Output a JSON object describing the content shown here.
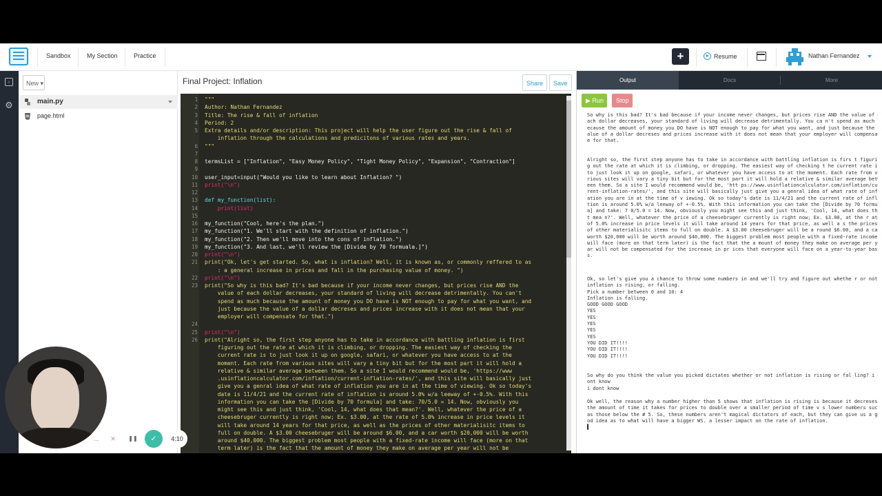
{
  "nav": {
    "links": [
      "Sandbox",
      "My Section",
      "Practice"
    ],
    "plus_label": "+",
    "resume_label": "Resume",
    "user_name": "Nathan Fernandez"
  },
  "files": {
    "new_label": "New",
    "items": [
      "main.py",
      "page.html"
    ]
  },
  "editor": {
    "title": "Final Project: Inflation",
    "share_label": "Share",
    "save_label": "Save",
    "lines": [
      {
        "n": "1",
        "t": "\"\"\""
      },
      {
        "n": "2",
        "t": "Author: Nathan Fernandez"
      },
      {
        "n": "3",
        "t": "Title: The rise & fall of inflation"
      },
      {
        "n": "4",
        "t": "Period: 2"
      },
      {
        "n": "5",
        "t": "Extra details and/or description: This project will help the user figure out the rise & fall of\n    inflation through the calculations and predicitons of various rates and years."
      },
      {
        "n": "6",
        "t": "\"\"\""
      },
      {
        "n": "7",
        "t": ""
      },
      {
        "n": "8",
        "t": "termsList = [\"Inflation\", \"Easy Money Policy\", \"Tight Money Policy\", \"Expansion\", \"Contraction\"]"
      },
      {
        "n": "9",
        "t": ""
      },
      {
        "n": "10",
        "t": "user_input=input(\"Would you like to learn about Inflation? \")"
      },
      {
        "n": "11",
        "t": "print(\"\\n\")"
      },
      {
        "n": "12",
        "t": ""
      },
      {
        "n": "13",
        "t": "def my_function(list):"
      },
      {
        "n": "14",
        "t": "    print(list)"
      },
      {
        "n": "15",
        "t": ""
      },
      {
        "n": "16",
        "t": "my_function(\"Cool, here's the plan.\")"
      },
      {
        "n": "17",
        "t": "my_function(\"1. We'll start with the definition of inflation.\")"
      },
      {
        "n": "18",
        "t": "my_function(\"2. Then we'll move into the cons of inflation.\")"
      },
      {
        "n": "19",
        "t": "my_function(\"3. And last, we'll review the [Divide by 70 formuala.]\")"
      },
      {
        "n": "20",
        "t": "print(\"\\n\")"
      },
      {
        "n": "21",
        "t": "print(\"Ok, let's get started. So, what is inflation? Well, it is known as, or commonly reffered to as\n    : a general increase in prices and fall in the purchasing value of money. \")"
      },
      {
        "n": "22",
        "t": "print(\"\\n\")"
      },
      {
        "n": "23",
        "t": "print(\"So why is this bad? It's bad because if your income never changes, but prices rise AND the\n    value of each dollar decreases, your standard of living will decrease detrimentally. You can't\n    spend as much because the amount of money you DO have is NOT enough to pay for what you want, and\n    just because the value of a dollar decreses and prices increase with it does not mean that your\n    employer will compensate for that.\")"
      },
      {
        "n": "24",
        "t": ""
      },
      {
        "n": "25",
        "t": "print(\"\\n\")"
      },
      {
        "n": "26",
        "t": "print(\"Alright so, the first step anyone has to take in accordance with battling inflation is first\n    figuring out the rate at which it is climbing, or dropping. The easiest way of checking the\n    current rate is to just look it up on google, safari, or whatever you have access to at the\n    moment. Each rate from various sites will vary a tiny bit but for the most part it will hold a\n    relative & similar average between them. So a site I would recommend would be, 'https://www\n    .usinflationcalculator.com/inflation/current-inflation-rates/', and this site will basically just\n    give you a genral idea of what rate of inflation you are in at the time of viewing. Ok so today's\n    date is 11/4/21 and the current rate of inflation is around 5.0% w/a leeway of +-0.5%. With this\n    information you can take the [Divide by 70 formula] and take: 70/5.0 = 14. Now, obviously you\n    might see this and just think, 'Cool, 14, what does that mean?'. Well, whatever the price of a\n    cheesebruger currently is right now; Ex. $3.00, at the rate of 5.0% increase in price levels it\n    will take around 14 years for that price, as well as the prices of other materialisitc items to\n    full on double. A $3.00 cheesebruger will be around $6.00, and a car worth $20,000 will be worth\n    around $40,000. The biggest problem most people with a fixed-rate income will face (more on that\n    term later) is the fact that the amount of money they make on average per year will not be"
      }
    ]
  },
  "output": {
    "tabs": [
      "Output",
      "Docs",
      "More"
    ],
    "run_label": "Run",
    "stop_label": "Stop",
    "blocks": [
      "So why is this bad? It's bad because if your income never changes, but prices rise AND the value of each dollar decreases, your standard of living will decrease detrimentally. You ca n't spend as much because the amount of money you DO have is NOT enough to pay for what you want, and just because the value of a dollar decreses and prices increase with it does not mean that your employer will compensate for that.",
      "Alright so, the first step anyone has to take in accordance with battling inflation is firs t figuring out the rate at which it is climbing, or dropping. The easiest way of checking t he current rate is to just look it up on google, safari, or whatever you have access to at the moment. Each rate from various sites will vary a tiny bit but for the most part it will hold a relative & similar average between them. So a site I would recommend would be, 'htt ps://www.usinflationcalculator.com/inflation/current-inflation-rates/', and this site will basically just give you a genral idea of what rate of inflation you are in at the time of v iewing. Ok so today's date is 11/4/21 and the current rate of inflation is around 5.0% w/a leeway of +-0.5%. With this information you can take the [Divide by 70 formula] and take: 7 0/5.0 = 14. Now, obviously you might see this and just think, 'Cool, 14, what does that mea n?'. Well, whatever the price of a cheesebruger currently is right now; Ex. $3.00, at the r ate of 5.0% increase in price levels it will take around 14 years for that price, as well a s the prices of other materialisitc items to full on double. A $3.00 cheesebruger will be a round $6.00, and a car worth $20,000 will be worth around $40,000. The biggest problem most people with a fixed-rate income will face (more on that term later) is the fact that the a mount of money they make on average per year will not be compensated for the increase in pr ices that everyone will face on a year-to-year basis.",
      "Ok, so let's give you a chance to throw some numbers in and we'll try and figure out whethe r or not inflation is rising, or falling.\nPick a number between 0 and 10: 4\nInflation is falling.\nGOOD GOOD GOOD\nYES\nYES\nYES\nYES\nYES\nYOU DID IT!!!!\nYOU DID IT!!!!\nYOU DID IT!!!!",
      "So why do you think the value you picked dictates whether or not inflation is rising or fal ling? i dont know\ni dont know",
      "Ok well, the reason why a number higher than 5 shows that inflation is rising is because it decreses the amount of time it takes for prices to double over a smaller period of time v s lower numbers such as those below the # 5. So, these numbers aren't magical dictators of each, but they can give us a good idea as to what will have a bigger WS. a lesser impact on the rate of inflation.\n▌"
    ]
  },
  "recorder": {
    "more_label": "...",
    "cancel_glyph": "✕",
    "pause_glyph": "❚❚",
    "done_glyph": "✓",
    "time": "4:10"
  },
  "colors": {
    "accent": "#2b9fd6",
    "run": "#8cc63f",
    "stop": "#e88a8a",
    "dark": "#232a33",
    "code_bg": "#272822"
  }
}
